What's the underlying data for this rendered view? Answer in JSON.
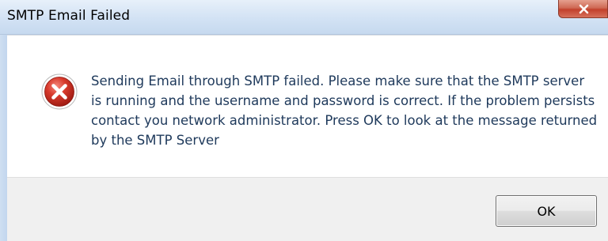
{
  "window": {
    "title": "SMTP Email Failed"
  },
  "dialog": {
    "icon": "error-icon",
    "message": "Sending Email through SMTP failed. Please make sure that the SMTP server is running and the username and password is correct. If the problem persists contact you network administrator. Press OK to look at the message returned by the SMTP Server"
  },
  "buttons": {
    "ok_label": "OK",
    "close_glyph": "x"
  },
  "colors": {
    "message_text": "#1e395b",
    "error_red": "#c8241b",
    "close_button": "#c2402c"
  }
}
